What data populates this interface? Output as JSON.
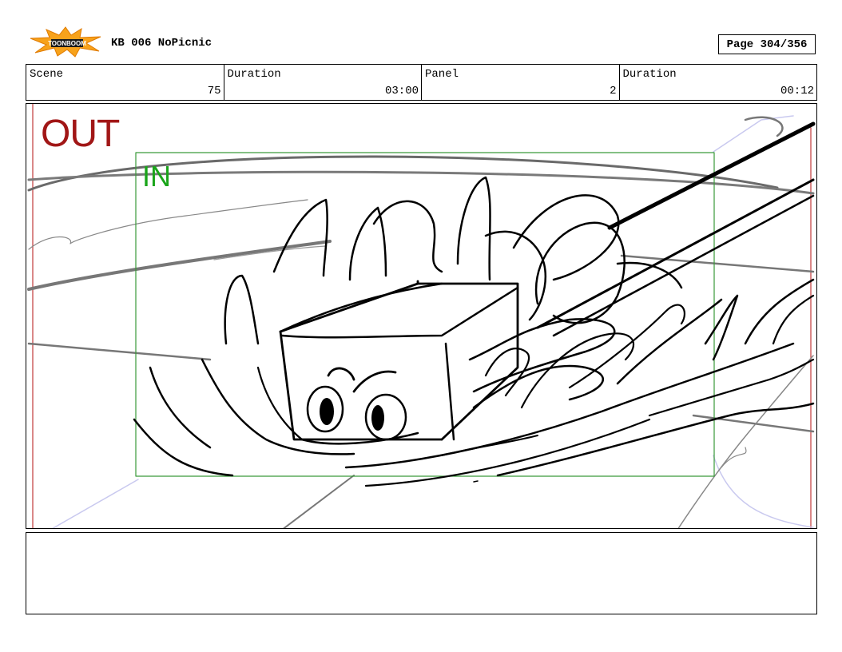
{
  "header": {
    "logo_text": "TOONBOOM",
    "title": "KB 006 NoPicnic",
    "page": "Page 304/356"
  },
  "info": {
    "scene": {
      "label": "Scene",
      "value": "75"
    },
    "scene_duration": {
      "label": "Duration",
      "value": "03:00"
    },
    "panel": {
      "label": "Panel",
      "value": "2"
    },
    "panel_duration": {
      "label": "Duration",
      "value": "00:12"
    }
  },
  "panel": {
    "out_label": "OUT",
    "in_label": "IN",
    "out_color": "#a11616",
    "in_color": "#1aa51a"
  },
  "notes": {
    "text": ""
  }
}
